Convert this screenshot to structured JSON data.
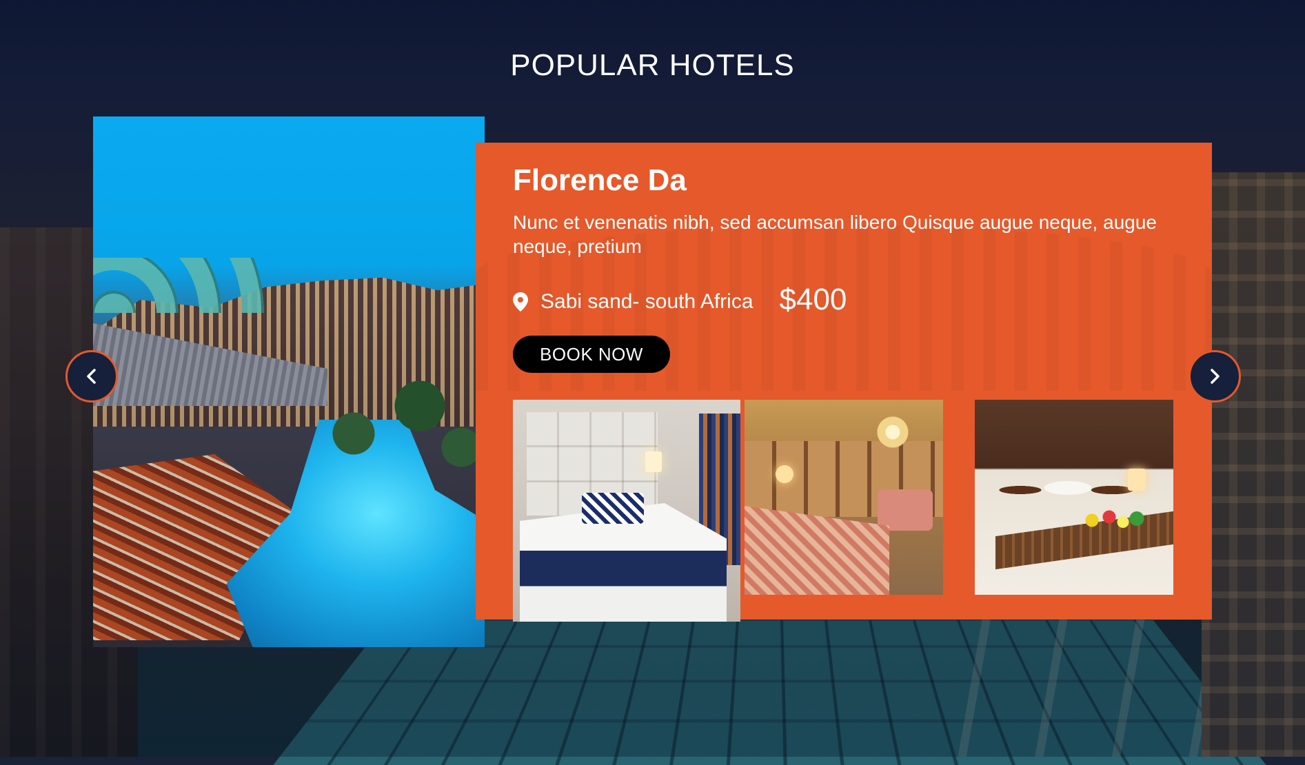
{
  "section": {
    "title": "POPULAR HOTELS"
  },
  "hotel": {
    "name": "Florence Da",
    "description": "Nunc et venenatis nibh, sed accumsan libero Quisque augue neque, augue neque, pretium",
    "location": "Sabi sand- south Africa",
    "price": "$400",
    "book_label": "BOOK NOW"
  },
  "icons": {
    "location": "map-pin-icon",
    "prev": "chevron-left-icon",
    "next": "chevron-right-icon"
  },
  "colors": {
    "accent": "#e5592b",
    "button_bg": "#000000",
    "nav_bg": "#16203a",
    "text": "#ffffff"
  }
}
